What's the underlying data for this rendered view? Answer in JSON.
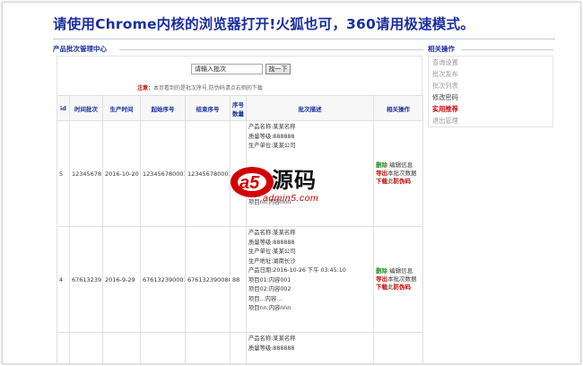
{
  "banner": "请使用Chrome内核的浏览器打开!火狐也可，360请用极速模式。",
  "main": {
    "title": "产品批次管理中心",
    "search_placeholder": "请输入批次",
    "search_button": "找一下",
    "notice_tag": "注意：",
    "notice_text": "本页看到的是批次序号,防伪码请点右侧的下载"
  },
  "table": {
    "headers": [
      "id",
      "时间批次",
      "生产时间",
      "起始序号",
      "结束序号",
      "序号数量",
      "批次描述",
      "相关操作"
    ],
    "rows": [
      {
        "id": "5",
        "batch": "12345678",
        "date": "2016-10-20",
        "start": "123456780001",
        "end": "123456780001",
        "count": "",
        "info": [
          "产品名称:某某名称",
          "质量等级:888888",
          "生产单位:某某公司",
          "",
          "",
          "",
          "",
          "",
          "项目nn:内容nnn"
        ],
        "ops": {
          "delete": "删除",
          "edit": "编辑信息",
          "export": "导出",
          "export_text": "本批次数据",
          "download": "下载",
          "download_text": "此",
          "download_tail": "防伪码"
        }
      },
      {
        "id": "4",
        "batch": "67613239",
        "date": "2016-9-29",
        "start": "676132390001",
        "end": "676132390088",
        "count": "88",
        "info": [
          "产品名称:某某名称",
          "质量等级:888888",
          "生产单位:某某公司",
          "生产地址:湖南长沙",
          "产品日期:2016-10-26 下午 03:45:10",
          "项目01:内容001",
          "项目02:内容002",
          "项目...内容...",
          "项目nn:内容nnn"
        ],
        "ops": {
          "delete": "删除",
          "edit": "编辑信息",
          "export": "导出",
          "export_text": "本批次数据",
          "download": "下载",
          "download_text": "此",
          "download_tail": "防伪码"
        }
      },
      {
        "id": "",
        "batch": "",
        "date": "",
        "start": "",
        "end": "",
        "count": "",
        "info": [
          "产品名称:某某名称",
          "质量等级:888888"
        ],
        "ops": {
          "delete": "",
          "edit": "",
          "export": "",
          "export_text": "",
          "download": "",
          "download_text": "",
          "download_tail": ""
        }
      }
    ]
  },
  "side": {
    "title": "相关操作",
    "items": [
      "查询设置",
      "批次发布",
      "批次列表",
      "修改密码",
      "实用推荐",
      "退出管理"
    ]
  },
  "watermark": {
    "brand": "源码",
    "url": "admin5.com"
  },
  "colors": {
    "title_blue": "#1a2e9e",
    "accent_red": "#cc0000",
    "ok_green": "#2a8a2a"
  }
}
